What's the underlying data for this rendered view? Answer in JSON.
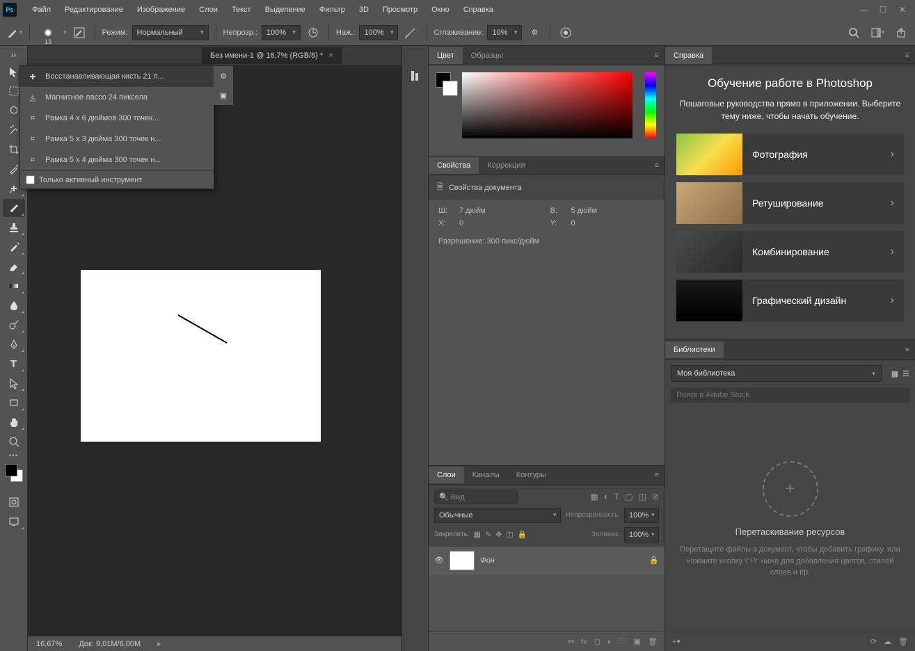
{
  "menubar": [
    "Файл",
    "Редактирование",
    "Изображение",
    "Слои",
    "Текст",
    "Выделение",
    "Фильтр",
    "3D",
    "Просмотр",
    "Окно",
    "Справка"
  ],
  "options": {
    "brush_size": "13",
    "mode_label": "Режим:",
    "mode_value": "Нормальный",
    "opacity_label": "Непрозр.:",
    "opacity_value": "100%",
    "flow_label": "Наж.:",
    "flow_value": "100%",
    "smoothing_label": "Сглаживание:",
    "smoothing_value": "10%"
  },
  "presets": {
    "items": [
      "Восстанавливающая кисть 21 п...",
      "Магнитное лассо 24 пиксела",
      "Рамка 4 x 6 дюймов 300 точек...",
      "Рамка 5 x 3 дюйма 300 точек н...",
      "Рамка 5 x 4 дюйма 300 точек н..."
    ],
    "footer": "Только активный инструмент"
  },
  "doc_tab": "Без имени-1 @ 16,7% (RGB/8) *",
  "status": {
    "zoom": "16,67%",
    "doc_label": "Док:",
    "doc_value": "9,01M/6,00M"
  },
  "color_tabs": [
    "Цвет",
    "Образцы"
  ],
  "props_tabs": [
    "Свойства",
    "Коррекция"
  ],
  "props": {
    "header": "Свойства документа",
    "w_label": "Ш:",
    "w_value": "7 дюйм",
    "h_label": "В:",
    "h_value": "5 дюйм",
    "x_label": "X:",
    "x_value": "0",
    "y_label": "Y:",
    "y_value": "0",
    "res_label": "Разрешение:",
    "res_value": "300 пикс/дюйм"
  },
  "layers_tabs": [
    "Слои",
    "Каналы",
    "Контуры"
  ],
  "layers": {
    "search_placeholder": "Вид",
    "blend": "Обычные",
    "opacity_label": "Непрозрачность:",
    "opacity_value": "100%",
    "lock_label": "Закрепить:",
    "fill_label": "Заливка:",
    "fill_value": "100%",
    "layer_name": "Фон"
  },
  "help_tab": "Справка",
  "learn": {
    "title": "Обучение работе в Photoshop",
    "subtitle": "Пошаговые руководства прямо в приложении. Выберите тему ниже, чтобы начать обучение.",
    "cards": [
      "Фотография",
      "Ретуширование",
      "Комбинирование",
      "Графический дизайн"
    ]
  },
  "lib_tab": "Библиотеки",
  "lib": {
    "selected": "Моя библиотека",
    "search_placeholder": "Поиск в Adobe Stock",
    "drop_title": "Перетаскивание ресурсов",
    "drop_text": "Перетащите файлы в документ, чтобы добавить графику, или нажмите кнопку \\\"+\\\" ниже для добавления цветов, стилей слоев и пр."
  }
}
